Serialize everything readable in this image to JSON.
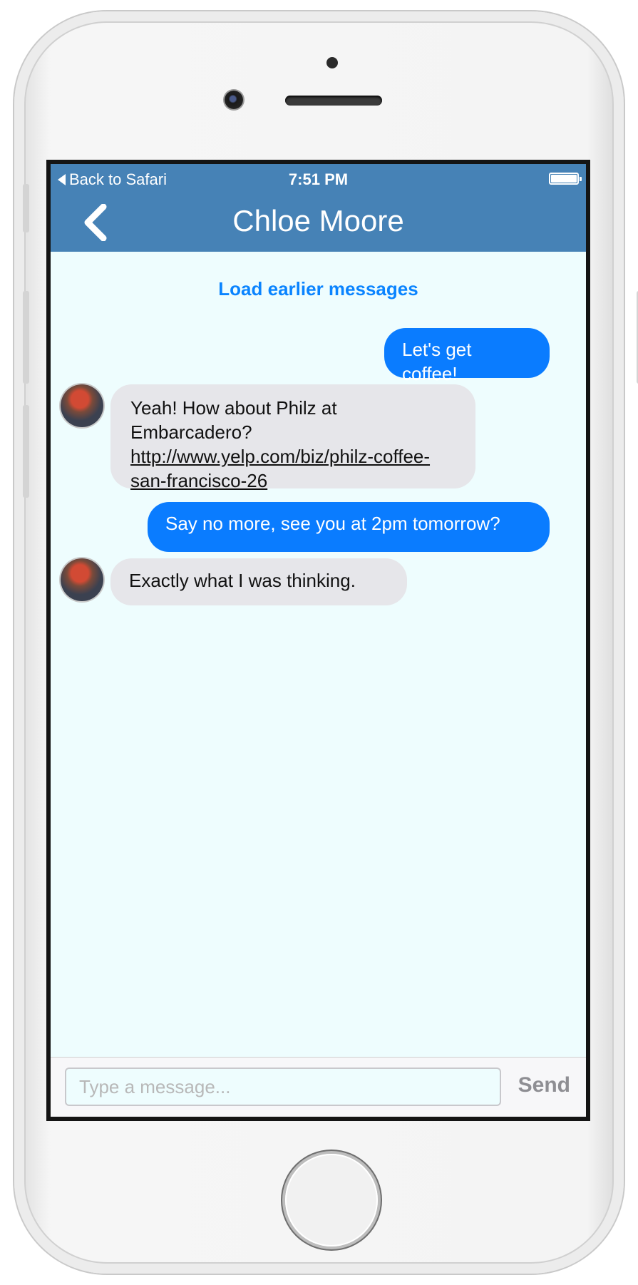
{
  "status_bar": {
    "back_label": "Back to Safari",
    "time": "7:51 PM",
    "battery_icon": "battery-full-icon"
  },
  "nav": {
    "back_icon": "chevron-left-icon",
    "title": "Chloe Moore"
  },
  "load_earlier_label": "Load earlier messages",
  "messages": [
    {
      "direction": "outgoing",
      "text": "Let's get coffee!"
    },
    {
      "direction": "incoming",
      "text_prefix": "Yeah! How about Philz at Embarcadero? ",
      "link": "http://www.yelp.com/biz/philz-coffee-san-francisco-26"
    },
    {
      "direction": "outgoing",
      "text": "Say no more, see you at 2pm tomorrow?"
    },
    {
      "direction": "incoming",
      "text": "Exactly what I was thinking."
    }
  ],
  "composer": {
    "placeholder": "Type a message...",
    "send_label": "Send"
  },
  "colors": {
    "header": "#4682b6",
    "outgoing_bubble": "#0a7cff",
    "incoming_bubble": "#e6e6ea",
    "chat_background": "#eefdfe",
    "link_accent": "#0a84ff"
  }
}
